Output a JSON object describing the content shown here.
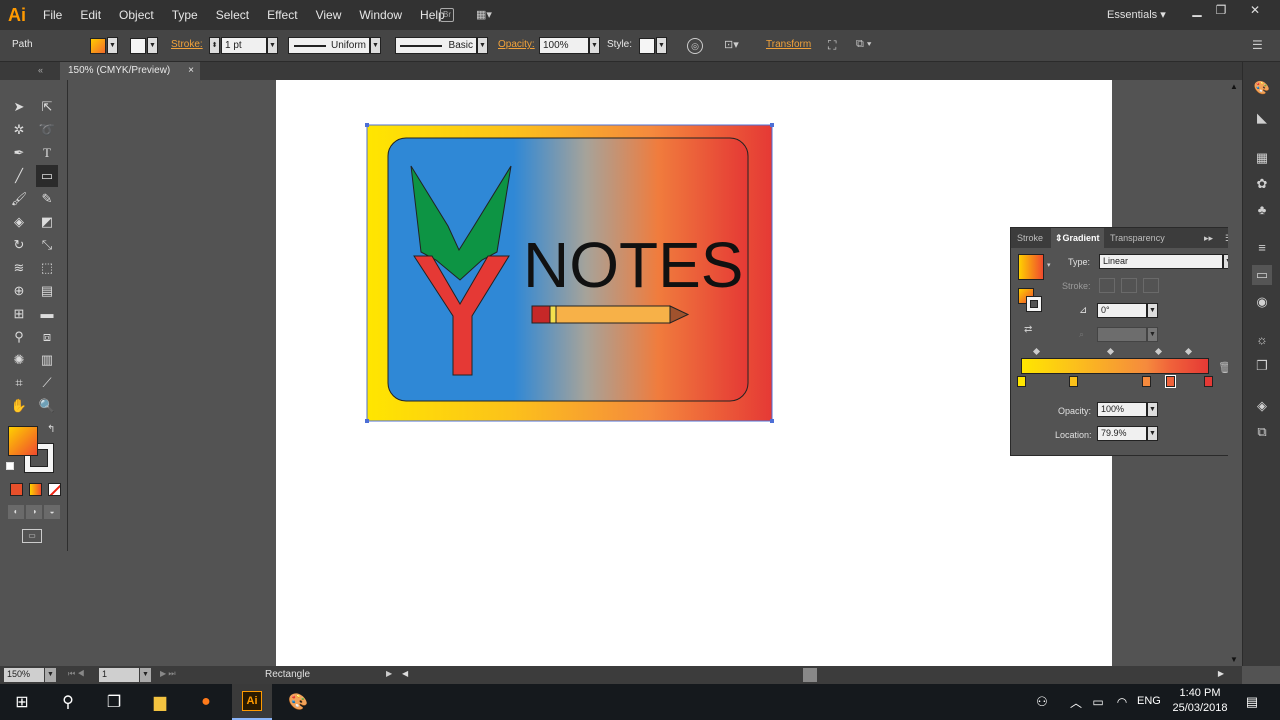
{
  "app": {
    "logo": "Ai",
    "menu": [
      "File",
      "Edit",
      "Object",
      "Type",
      "Select",
      "Effect",
      "View",
      "Window",
      "Help"
    ],
    "workspace": "Essentials"
  },
  "control_bar": {
    "selection_type": "Path",
    "stroke_label": "Stroke:",
    "stroke_weight": "1 pt",
    "profile": "Uniform",
    "brush": "Basic",
    "opacity_label": "Opacity:",
    "opacity_value": "100%",
    "style_label": "Style:",
    "transform_label": "Transform"
  },
  "document": {
    "tab_title": "150% (CMYK/Preview)",
    "close": "×"
  },
  "artwork": {
    "notes_text": "NOTES",
    "gradient_colors": [
      "#ffe600",
      "#fcc21a",
      "#f58a3d",
      "#e53935"
    ],
    "blue": "#2f88d6",
    "green": "#0d9444",
    "red": "#e53935"
  },
  "gradient_panel": {
    "tabs": [
      "Stroke",
      "Gradient",
      "Transparency"
    ],
    "type_label": "Type:",
    "type_value": "Linear",
    "stroke_label": "Stroke:",
    "angle_value": "0°",
    "opacity_label": "Opacity:",
    "opacity_value": "100%",
    "location_label": "Location:",
    "location_value": "79.9%"
  },
  "status_bar": {
    "zoom": "150%",
    "page": "1",
    "tool": "Rectangle"
  },
  "taskbar": {
    "language": "ENG",
    "time": "1:40 PM",
    "date": "25/03/2018"
  }
}
